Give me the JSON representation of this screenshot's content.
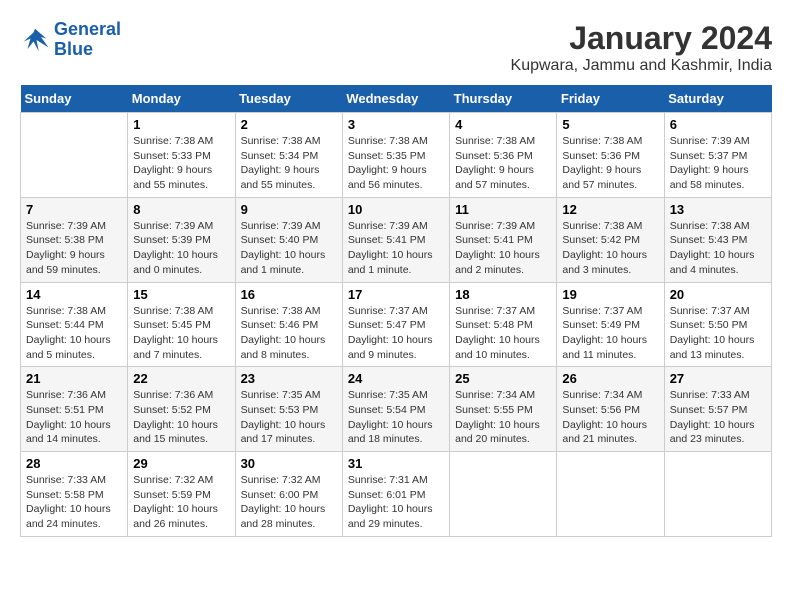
{
  "header": {
    "logo_line1": "General",
    "logo_line2": "Blue",
    "title": "January 2024",
    "subtitle": "Kupwara, Jammu and Kashmir, India"
  },
  "weekdays": [
    "Sunday",
    "Monday",
    "Tuesday",
    "Wednesday",
    "Thursday",
    "Friday",
    "Saturday"
  ],
  "weeks": [
    [
      {
        "day": "",
        "info": ""
      },
      {
        "day": "1",
        "info": "Sunrise: 7:38 AM\nSunset: 5:33 PM\nDaylight: 9 hours\nand 55 minutes."
      },
      {
        "day": "2",
        "info": "Sunrise: 7:38 AM\nSunset: 5:34 PM\nDaylight: 9 hours\nand 55 minutes."
      },
      {
        "day": "3",
        "info": "Sunrise: 7:38 AM\nSunset: 5:35 PM\nDaylight: 9 hours\nand 56 minutes."
      },
      {
        "day": "4",
        "info": "Sunrise: 7:38 AM\nSunset: 5:36 PM\nDaylight: 9 hours\nand 57 minutes."
      },
      {
        "day": "5",
        "info": "Sunrise: 7:38 AM\nSunset: 5:36 PM\nDaylight: 9 hours\nand 57 minutes."
      },
      {
        "day": "6",
        "info": "Sunrise: 7:39 AM\nSunset: 5:37 PM\nDaylight: 9 hours\nand 58 minutes."
      }
    ],
    [
      {
        "day": "7",
        "info": "Sunrise: 7:39 AM\nSunset: 5:38 PM\nDaylight: 9 hours\nand 59 minutes."
      },
      {
        "day": "8",
        "info": "Sunrise: 7:39 AM\nSunset: 5:39 PM\nDaylight: 10 hours\nand 0 minutes."
      },
      {
        "day": "9",
        "info": "Sunrise: 7:39 AM\nSunset: 5:40 PM\nDaylight: 10 hours\nand 1 minute."
      },
      {
        "day": "10",
        "info": "Sunrise: 7:39 AM\nSunset: 5:41 PM\nDaylight: 10 hours\nand 1 minute."
      },
      {
        "day": "11",
        "info": "Sunrise: 7:39 AM\nSunset: 5:41 PM\nDaylight: 10 hours\nand 2 minutes."
      },
      {
        "day": "12",
        "info": "Sunrise: 7:38 AM\nSunset: 5:42 PM\nDaylight: 10 hours\nand 3 minutes."
      },
      {
        "day": "13",
        "info": "Sunrise: 7:38 AM\nSunset: 5:43 PM\nDaylight: 10 hours\nand 4 minutes."
      }
    ],
    [
      {
        "day": "14",
        "info": "Sunrise: 7:38 AM\nSunset: 5:44 PM\nDaylight: 10 hours\nand 5 minutes."
      },
      {
        "day": "15",
        "info": "Sunrise: 7:38 AM\nSunset: 5:45 PM\nDaylight: 10 hours\nand 7 minutes."
      },
      {
        "day": "16",
        "info": "Sunrise: 7:38 AM\nSunset: 5:46 PM\nDaylight: 10 hours\nand 8 minutes."
      },
      {
        "day": "17",
        "info": "Sunrise: 7:37 AM\nSunset: 5:47 PM\nDaylight: 10 hours\nand 9 minutes."
      },
      {
        "day": "18",
        "info": "Sunrise: 7:37 AM\nSunset: 5:48 PM\nDaylight: 10 hours\nand 10 minutes."
      },
      {
        "day": "19",
        "info": "Sunrise: 7:37 AM\nSunset: 5:49 PM\nDaylight: 10 hours\nand 11 minutes."
      },
      {
        "day": "20",
        "info": "Sunrise: 7:37 AM\nSunset: 5:50 PM\nDaylight: 10 hours\nand 13 minutes."
      }
    ],
    [
      {
        "day": "21",
        "info": "Sunrise: 7:36 AM\nSunset: 5:51 PM\nDaylight: 10 hours\nand 14 minutes."
      },
      {
        "day": "22",
        "info": "Sunrise: 7:36 AM\nSunset: 5:52 PM\nDaylight: 10 hours\nand 15 minutes."
      },
      {
        "day": "23",
        "info": "Sunrise: 7:35 AM\nSunset: 5:53 PM\nDaylight: 10 hours\nand 17 minutes."
      },
      {
        "day": "24",
        "info": "Sunrise: 7:35 AM\nSunset: 5:54 PM\nDaylight: 10 hours\nand 18 minutes."
      },
      {
        "day": "25",
        "info": "Sunrise: 7:34 AM\nSunset: 5:55 PM\nDaylight: 10 hours\nand 20 minutes."
      },
      {
        "day": "26",
        "info": "Sunrise: 7:34 AM\nSunset: 5:56 PM\nDaylight: 10 hours\nand 21 minutes."
      },
      {
        "day": "27",
        "info": "Sunrise: 7:33 AM\nSunset: 5:57 PM\nDaylight: 10 hours\nand 23 minutes."
      }
    ],
    [
      {
        "day": "28",
        "info": "Sunrise: 7:33 AM\nSunset: 5:58 PM\nDaylight: 10 hours\nand 24 minutes."
      },
      {
        "day": "29",
        "info": "Sunrise: 7:32 AM\nSunset: 5:59 PM\nDaylight: 10 hours\nand 26 minutes."
      },
      {
        "day": "30",
        "info": "Sunrise: 7:32 AM\nSunset: 6:00 PM\nDaylight: 10 hours\nand 28 minutes."
      },
      {
        "day": "31",
        "info": "Sunrise: 7:31 AM\nSunset: 6:01 PM\nDaylight: 10 hours\nand 29 minutes."
      },
      {
        "day": "",
        "info": ""
      },
      {
        "day": "",
        "info": ""
      },
      {
        "day": "",
        "info": ""
      }
    ]
  ]
}
